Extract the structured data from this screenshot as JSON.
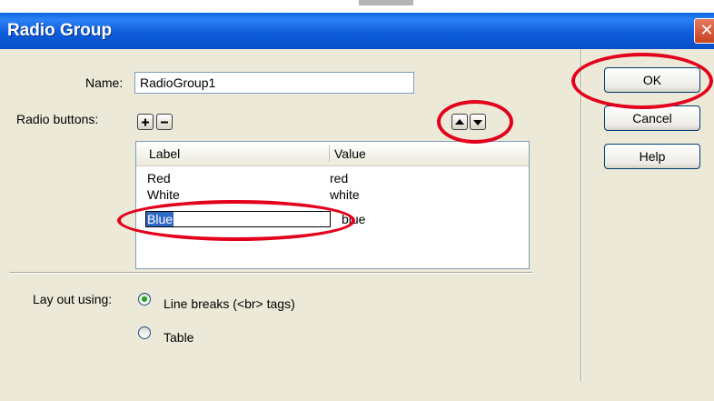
{
  "window": {
    "title": "Radio Group",
    "close_glyph": "✕"
  },
  "form": {
    "name_label": "Name:",
    "name_value": "RadioGroup1",
    "radio_buttons_label": "Radio buttons:"
  },
  "list": {
    "columns": [
      "Label",
      "Value"
    ],
    "rows": [
      {
        "label": "Red",
        "value": "red"
      },
      {
        "label": "White",
        "value": "white"
      },
      {
        "label": "Blue",
        "value": "blue",
        "editing": true
      }
    ]
  },
  "layout_options": {
    "label": "Lay out using:",
    "options": [
      {
        "text": "Line breaks (<br> tags)",
        "selected": true
      },
      {
        "text": "Table",
        "selected": false
      }
    ]
  },
  "buttons": {
    "ok": "OK",
    "cancel": "Cancel",
    "help": "Help"
  },
  "icons": {
    "add": "plus-icon",
    "remove": "minus-icon",
    "move_up": "arrow-up-icon",
    "move_down": "arrow-down-icon",
    "close": "close-icon"
  },
  "colors": {
    "titlebar": "#0A5BD8",
    "dialog_bg": "#ECE9D8",
    "annotation": "#E3001B",
    "selection": "#316AC5"
  }
}
